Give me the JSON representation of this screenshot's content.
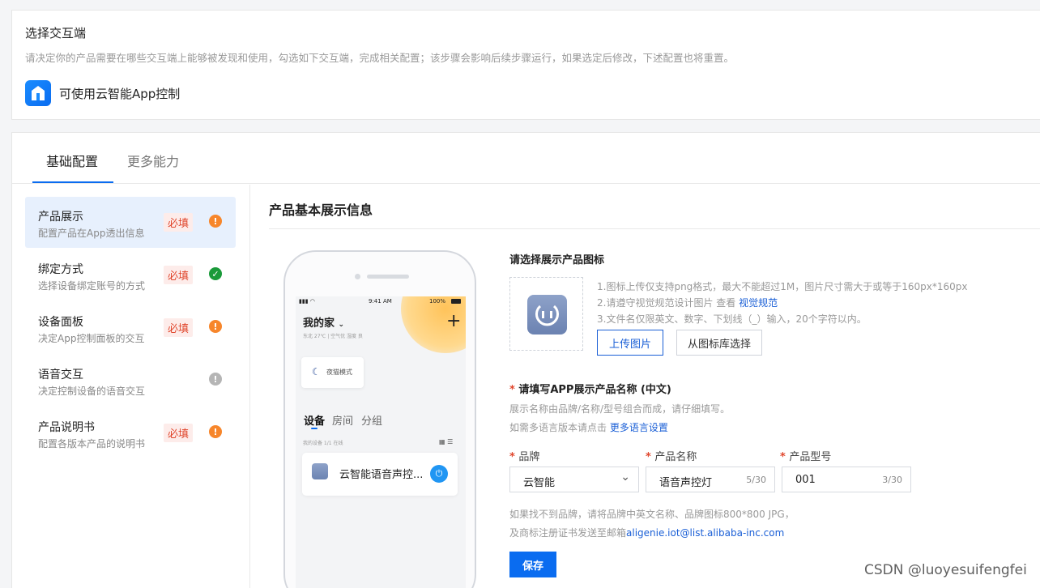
{
  "top": {
    "title": "选择交互端",
    "description": "请决定你的产品需要在哪些交互端上能够被发现和使用，勾选如下交互端，完成相关配置；该步骤会影响后续步骤运行，如果选定后修改，下述配置也将重置。",
    "app_label": "可使用云智能App控制"
  },
  "tabs": [
    {
      "label": "基础配置",
      "active": true
    },
    {
      "label": "更多能力",
      "active": false
    }
  ],
  "sidebar": {
    "items": [
      {
        "title": "产品展示",
        "sub": "配置产品在App透出信息",
        "badge": "必填",
        "status": "warning",
        "status_glyph": "!",
        "active": true
      },
      {
        "title": "绑定方式",
        "sub": "选择设备绑定账号的方式",
        "badge": "必填",
        "status": "ok",
        "status_glyph": "✓",
        "active": false
      },
      {
        "title": "设备面板",
        "sub": "决定App控制面板的交互",
        "badge": "必填",
        "status": "warning",
        "status_glyph": "!",
        "active": false
      },
      {
        "title": "语音交互",
        "sub": "决定控制设备的语音交互",
        "badge": "",
        "status": "neutral",
        "status_glyph": "!",
        "active": false
      },
      {
        "title": "产品说明书",
        "sub": "配置各版本产品的说明书",
        "badge": "必填",
        "status": "warning",
        "status_glyph": "!",
        "active": false
      }
    ]
  },
  "content": {
    "section_title": "产品基本展示信息",
    "phone": {
      "status_time": "9:41 AM",
      "status_battery": "100%",
      "home_title": "我的家",
      "home_sub": "东北 27℃ | 空气优 湿度 良",
      "plus": "+",
      "mode": "夜猫模式",
      "tabs": [
        "设备",
        "房间",
        "分组"
      ],
      "meta": "我的设备  1/1 在线",
      "device_name": "云智能语音声控...",
      "power_glyph": "⏻"
    },
    "icon_section": {
      "label": "请选择展示产品图标",
      "hints": [
        "1.图标上传仅支持png格式，最大不能超过1M，图片尺寸需大于或等于160px*160px",
        "2.请遵守视觉规范设计图片 查看 ",
        "3.文件名仅限英文、数字、下划线（_）输入，20个字符以内。"
      ],
      "spec_link": "视觉规范",
      "upload_button": "上传图片",
      "library_button": "从图标库选择"
    },
    "name_section": {
      "label": "请填写APP展示产品名称 (中文)",
      "hint1": "展示名称由品牌/名称/型号组合而成，请仔细填写。",
      "hint2": "如需多语言版本请点击 ",
      "multi_lang_link": "更多语言设置"
    },
    "fields": {
      "brand_label": "品牌",
      "brand_value": "云智能",
      "name_label": "产品名称",
      "name_value": "语音声控灯",
      "name_count": "5/30",
      "model_label": "产品型号",
      "model_value": "001",
      "model_count": "3/30"
    },
    "brand_hint1": "如果找不到品牌，请将品牌中英文名称、品牌图标800*800 JPG，",
    "brand_hint2": "及商标注册证书发送至邮箱",
    "email_link": "aligenie.iot@list.alibaba-inc.com",
    "save_button": "保存"
  },
  "watermark": "CSDN @luoyesuifengfei",
  "colors": {
    "accent": "#0a6cf0",
    "required": "#e0452b",
    "warning": "#f7862b",
    "ok": "#1a9a3a",
    "neutral": "#b5b5b5"
  }
}
